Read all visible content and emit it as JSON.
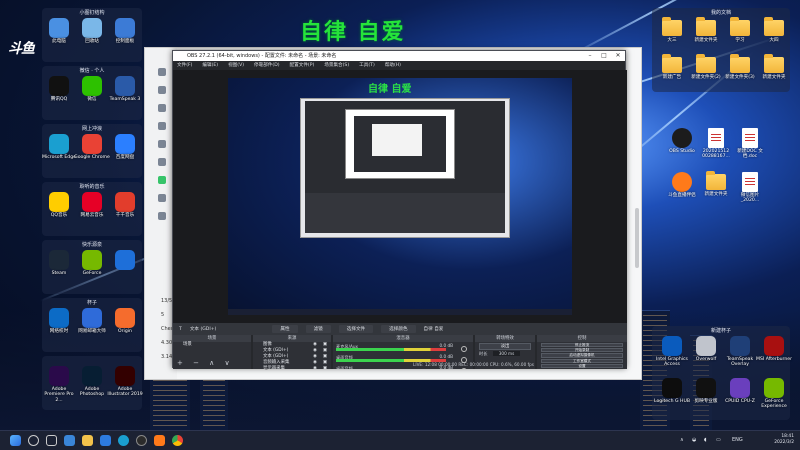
{
  "banner": {
    "text": "自律 自爱"
  },
  "logo": {
    "text": "斗鱼"
  },
  "left_groups": [
    {
      "title": "小图钉结构",
      "items": [
        {
          "label": "此电脑",
          "icon": "computer-icon",
          "color": "#4a90e2"
        },
        {
          "label": "回收站",
          "icon": "recycle-bin-icon",
          "color": "#7ab7e8"
        },
        {
          "label": "控制面板",
          "icon": "control-panel-icon",
          "color": "#3c7bd6"
        }
      ]
    },
    {
      "title": "微信 · 个人",
      "items": [
        {
          "label": "腾讯QQ",
          "icon": "qq-icon",
          "color": "#111"
        },
        {
          "label": "微信",
          "icon": "wechat-icon",
          "color": "#2dc100"
        },
        {
          "label": "TeamSpeak 3",
          "icon": "teamspeak-icon",
          "color": "#2a5aa8"
        }
      ]
    },
    {
      "title": "网上冲浪",
      "items": [
        {
          "label": "Microsoft Edge",
          "icon": "edge-icon",
          "color": "#1a9fd0"
        },
        {
          "label": "Google Chrome",
          "icon": "chrome-icon",
          "color": "#e94235"
        },
        {
          "label": "百度网盘",
          "icon": "baidu-netdisk-icon",
          "color": "#2b7fff"
        }
      ]
    },
    {
      "title": "聆听的音乐",
      "items": [
        {
          "label": "QQ音乐",
          "icon": "qq-music-icon",
          "color": "#ffcd00"
        },
        {
          "label": "网易云音乐",
          "icon": "netease-music-icon",
          "color": "#e60026"
        },
        {
          "label": "千千音乐",
          "icon": "qianqian-icon",
          "color": "#e23d2c"
        }
      ]
    },
    {
      "title": "快乐源泉",
      "items": [
        {
          "label": "Steam",
          "icon": "steam-icon",
          "color": "#1b2838"
        },
        {
          "label": "GeForce",
          "icon": "geforce-icon",
          "color": "#76b900"
        },
        {
          "label": "",
          "icon": "launcher-icon",
          "color": "#1e6fd9"
        }
      ]
    },
    {
      "title": "杯子",
      "items": [
        {
          "label": "网络校时",
          "icon": "time-sync-icon",
          "color": "#0c6bc6"
        },
        {
          "label": "网易邮箱大师",
          "icon": "mail-icon",
          "color": "#2f6bd9"
        },
        {
          "label": "Origin",
          "icon": "origin-icon",
          "color": "#f56c2d"
        }
      ]
    },
    {
      "title": "",
      "items": [
        {
          "label": "Adobe Premiere Pro 2...",
          "icon": "premiere-icon",
          "color": "#2a0a4a"
        },
        {
          "label": "Adobe Photoshop",
          "icon": "photoshop-icon",
          "color": "#071e33"
        },
        {
          "label": "Adobe Illustrator 2019",
          "icon": "illustrator-icon",
          "color": "#330000"
        }
      ]
    }
  ],
  "right_top_group": {
    "title": "我的文档",
    "items": [
      {
        "label": "大三",
        "type": "folder"
      },
      {
        "label": "新建文件夹",
        "type": "folder"
      },
      {
        "label": "学习",
        "type": "folder"
      },
      {
        "label": "大四",
        "type": "folder"
      },
      {
        "label": "新建广告",
        "type": "folder"
      },
      {
        "label": "新建文件夹(2)",
        "type": "folder"
      },
      {
        "label": "新建文件夹(3)",
        "type": "folder"
      },
      {
        "label": "新建文件夹",
        "type": "folder"
      }
    ]
  },
  "right_mid_items": [
    {
      "label": "OBS Studio",
      "type": "app",
      "color": "#1c1c1c"
    },
    {
      "label": "202021512 00288167...",
      "type": "doc"
    },
    {
      "label": "新建DOC 文档.doc",
      "type": "doc"
    },
    {
      "label": "斗鱼直播伴侣",
      "type": "app",
      "color": "#ff7a1a"
    },
    {
      "label": "新建文件夹",
      "type": "folder"
    },
    {
      "label": "微信图片_2020...",
      "type": "doc"
    }
  ],
  "right_bottom_group": {
    "title": "新建杯子",
    "items": [
      {
        "label": "Intel Graphics Access",
        "color": "#0a5bbd"
      },
      {
        "label": "Overwolf",
        "color": "#c0c4cc"
      },
      {
        "label": "TeamSpeak Overlay",
        "color": "#1f3f77"
      },
      {
        "label": "MSI Afterburner",
        "color": "#a81010"
      },
      {
        "label": "Logitech G HUB",
        "color": "#0d0d0d"
      },
      {
        "label": "剪映专业版",
        "color": "#111"
      },
      {
        "label": "CPUID CPU-Z",
        "color": "#6a3fbd"
      },
      {
        "label": "GeForce Experience",
        "color": "#76b900"
      }
    ]
  },
  "obs": {
    "title": "OBS 27.2.1 (64-bit, windows) - 配置文件: 未命名 - 场景: 未命名",
    "menu": [
      "文件(F)",
      "编辑(E)",
      "视图(V)",
      "停靠部件(D)",
      "配置文件(P)",
      "场景集合(S)",
      "工具(T)",
      "帮助(H)"
    ],
    "source_bar": {
      "current": "文本 (GDI+)",
      "tabs": [
        "属性",
        "滤镜",
        "选择文件",
        "选择颜色",
        "自律 自爱"
      ]
    },
    "docks": {
      "scenes": "场景",
      "sources": "来源",
      "mixer": "混音器",
      "transitions": "转场特效",
      "controls": "控制"
    },
    "scene_list": [
      "场景"
    ],
    "source_list": [
      "图像",
      "文本 (GDI+)",
      "文本 (GDI+)",
      "音频输入采集",
      "显示器采集",
      "显示器采集"
    ],
    "mixer_channels": [
      {
        "name": "麦克风/Aux",
        "db": "0.0 dB"
      },
      {
        "name": "桌面音频",
        "db": "0.0 dB"
      },
      {
        "name": "桌面音频",
        "db": "0.0 dB"
      }
    ],
    "transition": {
      "type": "淡出",
      "duration_label": "时长",
      "duration": "300 ms"
    },
    "controls": [
      "停止推流",
      "开始录制",
      "启动虚拟摄像机",
      "工作室模式",
      "设置",
      "退出"
    ],
    "status": "LIVE: 12:08  00:00:00   REC: 00:00:00   CPU: 0.6%, 60.00 fps"
  },
  "browser_side": [
    "",
    "",
    "",
    "",
    "",
    "",
    "",
    "",
    "",
    "13/5",
    "5",
    "Chec",
    "4.30",
    "3.14"
  ],
  "tray": {
    "lang": "ENG",
    "time": "18:41",
    "date": "2022/3/2"
  }
}
